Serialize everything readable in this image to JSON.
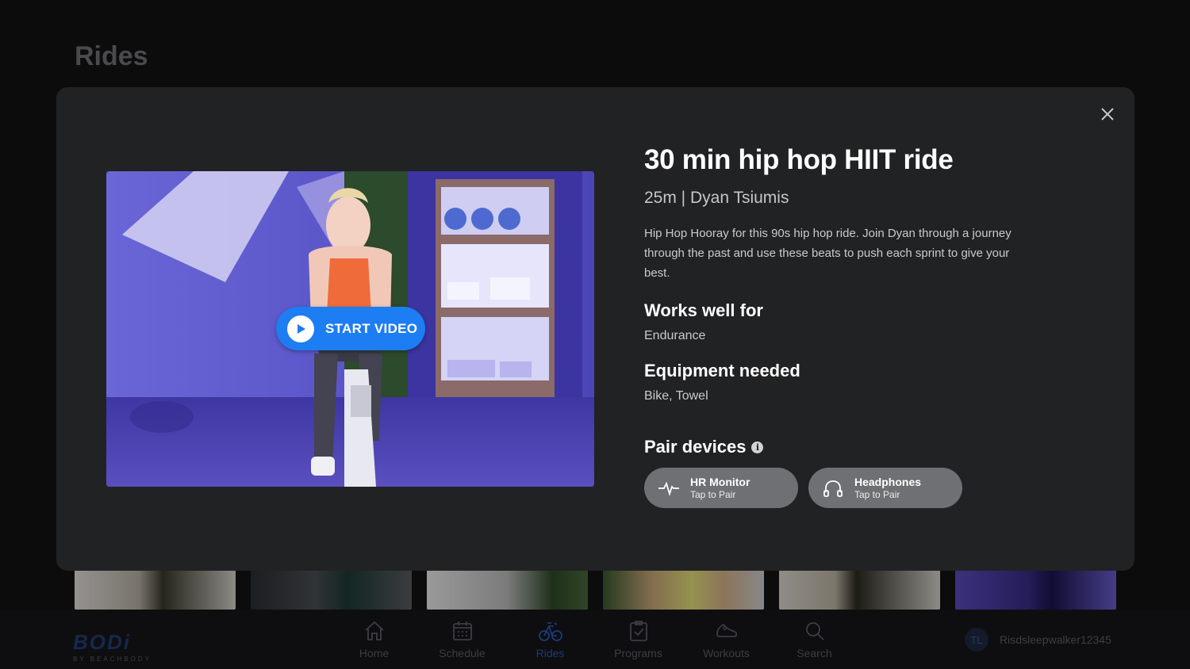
{
  "page": {
    "title": "Rides"
  },
  "nav": {
    "items": [
      {
        "label": "Home",
        "icon": "home-icon",
        "active": false
      },
      {
        "label": "Schedule",
        "icon": "calendar-icon",
        "active": false
      },
      {
        "label": "Rides",
        "icon": "bike-icon",
        "active": true
      },
      {
        "label": "Programs",
        "icon": "clipboard-check-icon",
        "active": false
      },
      {
        "label": "Workouts",
        "icon": "sneaker-icon",
        "active": false
      },
      {
        "label": "Search",
        "icon": "search-icon",
        "active": false
      }
    ]
  },
  "logo": {
    "main": "BODi",
    "sub": "BY BEACHBODY"
  },
  "user": {
    "initials": "TL",
    "name": "Risdsleepwalker12345"
  },
  "modal": {
    "start_label": "START VIDEO",
    "title": "30 min hip hop HIIT ride",
    "meta": "25m | Dyan Tsiumis",
    "description": "Hip Hop Hooray for this 90s hip hop ride. Join Dyan through a journey through the past and use these beats to push each sprint to give your best.",
    "works_well_heading": "Works well for",
    "works_well_value": "Endurance",
    "equipment_heading": "Equipment needed",
    "equipment_value": "Bike, Towel",
    "pair_heading": "Pair devices",
    "devices": [
      {
        "name": "HR Monitor",
        "sub": "Tap to Pair",
        "icon": "heartbeat-icon"
      },
      {
        "name": "Headphones",
        "sub": "Tap to Pair",
        "icon": "headphones-icon"
      }
    ]
  },
  "colors": {
    "accent": "#1d7df2",
    "modal_bg": "#212224",
    "device_pill": "#6f7073"
  }
}
